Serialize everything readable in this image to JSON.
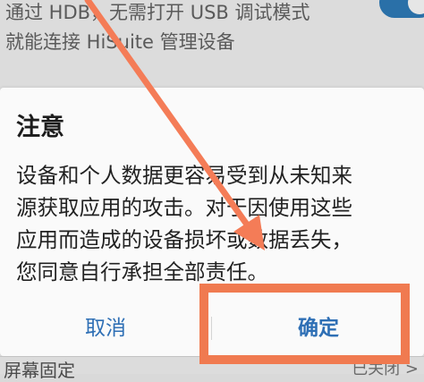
{
  "background": {
    "description_lines": [
      "通过 HDB，无需打开 USB 调试模式",
      "就能连接 HiSuite 管理设备"
    ],
    "bottom_left_text": "屏幕固定",
    "bottom_right_text": "已关闭 >"
  },
  "dialog": {
    "title": "注意",
    "message_lines": [
      "设备和个人数据更容易受到从未知来",
      "源获取应用的攻击。对于因使用这些",
      "应用而造成的设备损坏或数据丢失，",
      "您同意自行承担全部责任。"
    ],
    "cancel_label": "取消",
    "confirm_label": "确定"
  },
  "annotation": {
    "arrow_color": "#f47c57",
    "box_color": "#f07a50"
  },
  "colors": {
    "button_text": "#2e6fb5",
    "toggle_on": "#2a70a8"
  }
}
